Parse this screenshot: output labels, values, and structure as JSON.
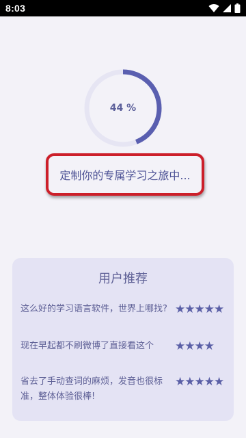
{
  "status_bar": {
    "time": "8:03"
  },
  "progress": {
    "value": 0.44,
    "label": "44 %",
    "track_color": "#e6e5f3",
    "fill_color": "#5a5fb0"
  },
  "journey": {
    "text": "定制你的专属学习之旅中...",
    "highlight_color": "#cc1f2a"
  },
  "recommendations": {
    "title": "用户推荐",
    "items": [
      {
        "comment": "这么好的学习语言软件，世界上哪找?",
        "stars": "★★★★★",
        "rating": 5
      },
      {
        "comment": "现在早起都不刷微博了直接看这个",
        "stars": "★★★★",
        "rating": 4
      },
      {
        "comment": "省去了手动查词的麻烦，发音也很标准，整体体验很棒!",
        "stars": "★★★★★",
        "rating": 5
      }
    ]
  }
}
